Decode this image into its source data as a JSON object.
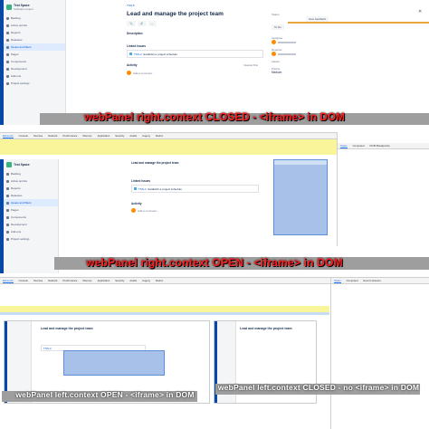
{
  "project": {
    "name": "Test Space",
    "type": "Software project"
  },
  "sidebar": {
    "items": [
      {
        "label": "Backlog"
      },
      {
        "label": "Active sprints"
      },
      {
        "label": "Reports"
      },
      {
        "label": "Releases"
      },
      {
        "label": "Issues and filters"
      },
      {
        "label": "Pages"
      },
      {
        "label": "Components"
      },
      {
        "label": "Development"
      },
      {
        "label": "Add-ons"
      },
      {
        "label": "Project settings"
      }
    ]
  },
  "issue": {
    "key": "TSS-5",
    "title": "Lead and manage the project team",
    "description_label": "Description",
    "linked_label": "Linked issues",
    "linked_row_key": "TSS-4",
    "linked_row_text": "Establish a project schedule",
    "status_label": "Status",
    "status_value": "To Do",
    "assignee_label": "Assignee",
    "reporter_label": "Reporter",
    "priority_label": "Priority",
    "priority_value": "Medium",
    "labels_label": "Labels",
    "activity_label": "Activity",
    "comment_placeholder": "Add a comment...",
    "sort_label": "Newest first",
    "watch_label": "Give feedback"
  },
  "devtools": {
    "tabs": [
      "Elements",
      "Console",
      "Sources",
      "Network",
      "Performance",
      "Memory",
      "Application",
      "Security",
      "Audits",
      "Augury",
      "Redux"
    ],
    "style_tabs": [
      "Styles",
      "Computed",
      "Event Listeners",
      "DOM Breakpoints"
    ]
  },
  "captions": {
    "top": "webPanel right.context CLOSED - <iframe> in DOM",
    "middle": "webPanel right.context OPEN - <iframe> in DOM",
    "bottom_left": "webPanel left.context OPEN - <iframe> in DOM",
    "bottom_right": "webPanel left.context CLOSED - no <iframe> in DOM"
  },
  "colors": {
    "caption": "#ff1e1e",
    "jira_nav": "#0747a6",
    "highlight": "#f9f59a",
    "panel_blue": "#a7c1e8"
  }
}
